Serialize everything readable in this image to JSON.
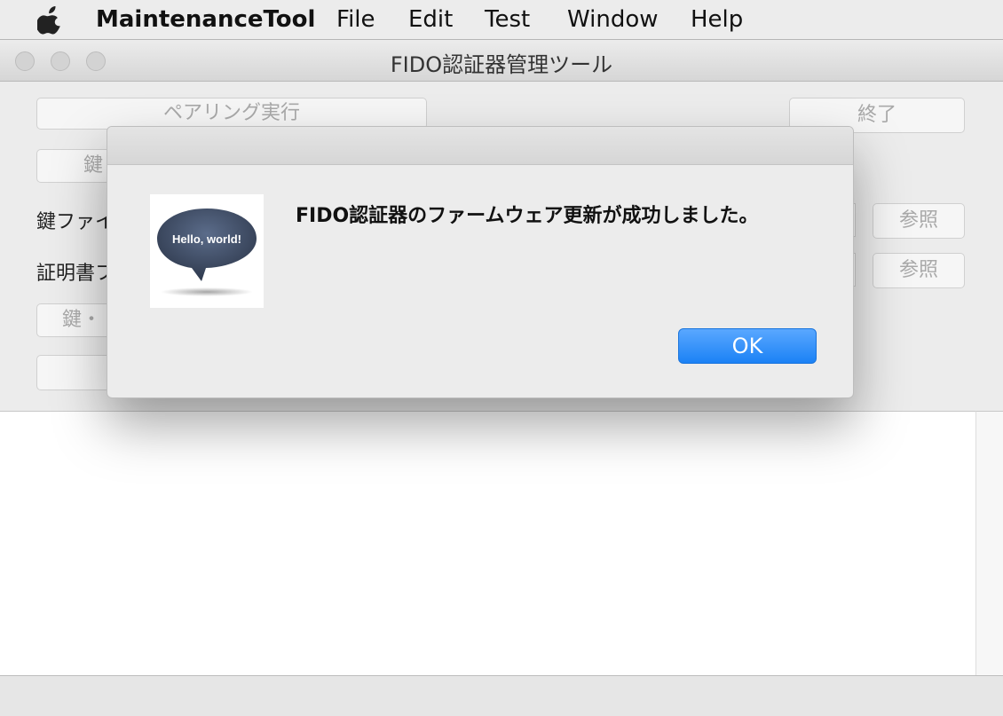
{
  "menubar": {
    "app_name": "MaintenanceTool",
    "items": [
      "File",
      "Edit",
      "Test",
      "Window",
      "Help"
    ]
  },
  "window": {
    "title": "FIDO認証器管理ツール",
    "pairing_button": "ペアリング実行",
    "quit_button": "終了",
    "key_button_partial": "鍵",
    "key_file_label_partial": "鍵ファイ",
    "cert_file_label_partial": "証明書フ",
    "browse_button_1": "参照",
    "browse_button_2": "参照",
    "key_cert_button_partial": "鍵・"
  },
  "dialog": {
    "message": "FIDO認証器のファームウェア更新が成功しました。",
    "ok_button": "OK",
    "icon_text": "Hello, world!"
  },
  "colors": {
    "accent_blue": "#1b82f5",
    "icon_bubble": "#3c4a63"
  }
}
